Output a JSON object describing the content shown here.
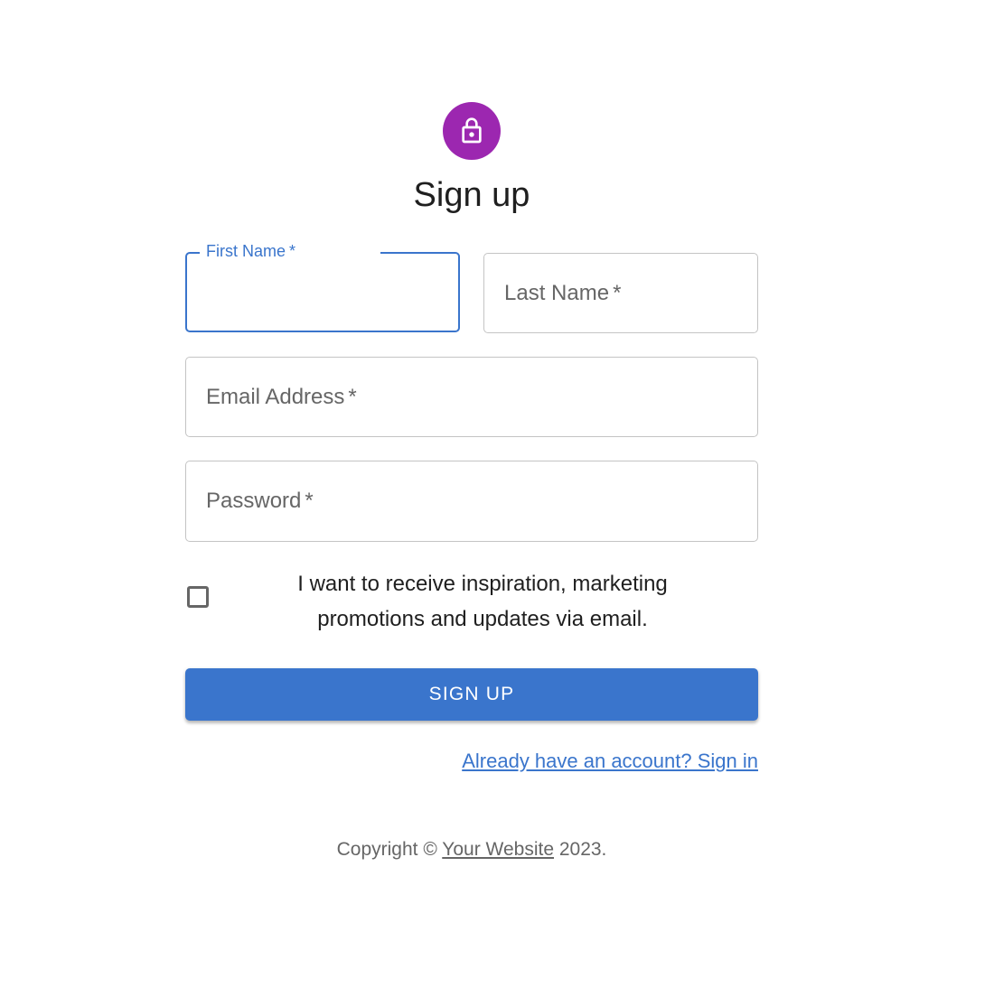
{
  "colors": {
    "avatar_bg": "#9c27b0",
    "primary": "#3a75cc",
    "text": "#1f1f1f",
    "muted": "#666666",
    "border": "#c4c4c4"
  },
  "header": {
    "icon": "lock-icon",
    "title": "Sign up"
  },
  "form": {
    "first_name": {
      "label": "First Name",
      "required_mark": "*",
      "value": "",
      "focused": true
    },
    "last_name": {
      "label": "Last Name",
      "required_mark": "*",
      "value": ""
    },
    "email": {
      "label": "Email Address",
      "required_mark": "*",
      "value": ""
    },
    "password": {
      "label": "Password",
      "required_mark": "*",
      "value": ""
    },
    "consent": {
      "checked": false,
      "label": "I want to receive inspiration, marketing promotions and updates via email."
    },
    "submit_label": "SIGN UP",
    "signin_link": "Already have an account? Sign in"
  },
  "footer": {
    "prefix": "Copyright © ",
    "link_text": "Your Website",
    "suffix": " 2023."
  }
}
